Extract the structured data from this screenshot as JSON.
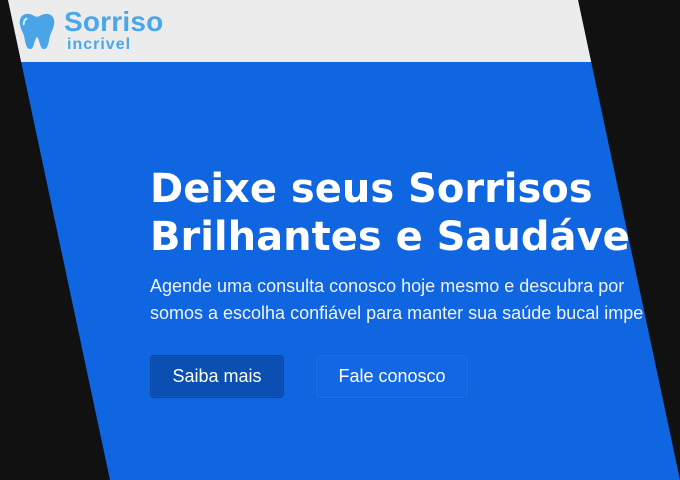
{
  "brand": {
    "name": "Sorriso",
    "subtitle": "incrivel",
    "icon": "tooth-icon",
    "color": "#4ba7ea"
  },
  "hero": {
    "title_line_1": "Deixe seus Sorrisos",
    "title_line_2": "Brilhantes e Saudáveis",
    "subtitle_line_1": "Agende uma consulta conosco hoje mesmo e descubra por",
    "subtitle_line_2": "somos a escolha confiável para manter sua saúde bucal impe",
    "background_color": "#1065e0"
  },
  "actions": {
    "primary_label": "Saiba mais",
    "secondary_label": "Fale conosco",
    "primary_color": "#0b4fb2",
    "secondary_color": "#1167e4"
  },
  "page": {
    "outer_background": "#111111",
    "header_background": "#ececec"
  }
}
